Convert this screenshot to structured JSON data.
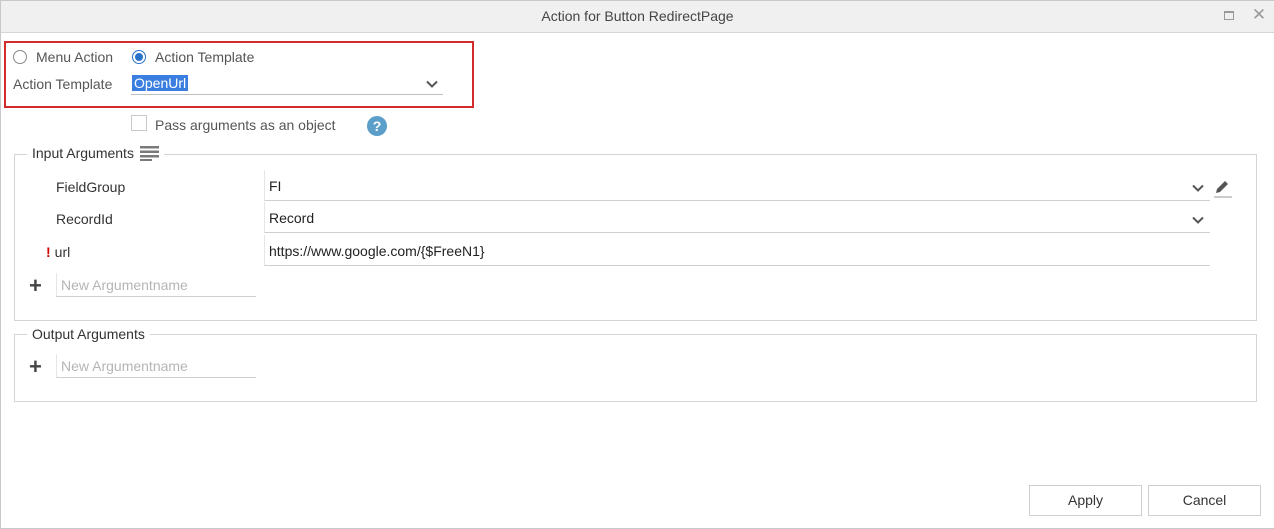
{
  "window": {
    "title": "Action for Button RedirectPage",
    "maximize_icon": "maximize-icon",
    "close_icon": "close-icon",
    "close_glyph": "✕"
  },
  "action_type": {
    "options": [
      "Menu Action",
      "Action Template"
    ],
    "selected": "Action Template"
  },
  "action_template": {
    "label": "Action Template",
    "value": "OpenUrl"
  },
  "pass_arguments": {
    "label": "Pass arguments as an object",
    "checked": false,
    "help_glyph": "?"
  },
  "input_arguments": {
    "title": "Input Arguments",
    "rows": [
      {
        "name": "FieldGroup",
        "value": "FI",
        "required": false,
        "type": "select",
        "editable": true
      },
      {
        "name": "RecordId",
        "value": "Record",
        "required": false,
        "type": "select",
        "editable": false
      },
      {
        "name": "url",
        "value": "https://www.google.com/{$FreeN1}",
        "required": true,
        "type": "text",
        "editable": false
      }
    ],
    "required_marker": "!",
    "add_glyph": "+",
    "new_placeholder": "New Argumentname"
  },
  "output_arguments": {
    "title": "Output Arguments",
    "add_glyph": "+",
    "new_placeholder": "New Argumentname"
  },
  "buttons": {
    "apply": "Apply",
    "cancel": "Cancel"
  },
  "colors": {
    "highlight_border": "#d12b2b",
    "radio_accent": "#2a73c9",
    "selection_bg": "#3a7fe0",
    "help_icon": "#5b9ec9",
    "required": "#d10000"
  }
}
